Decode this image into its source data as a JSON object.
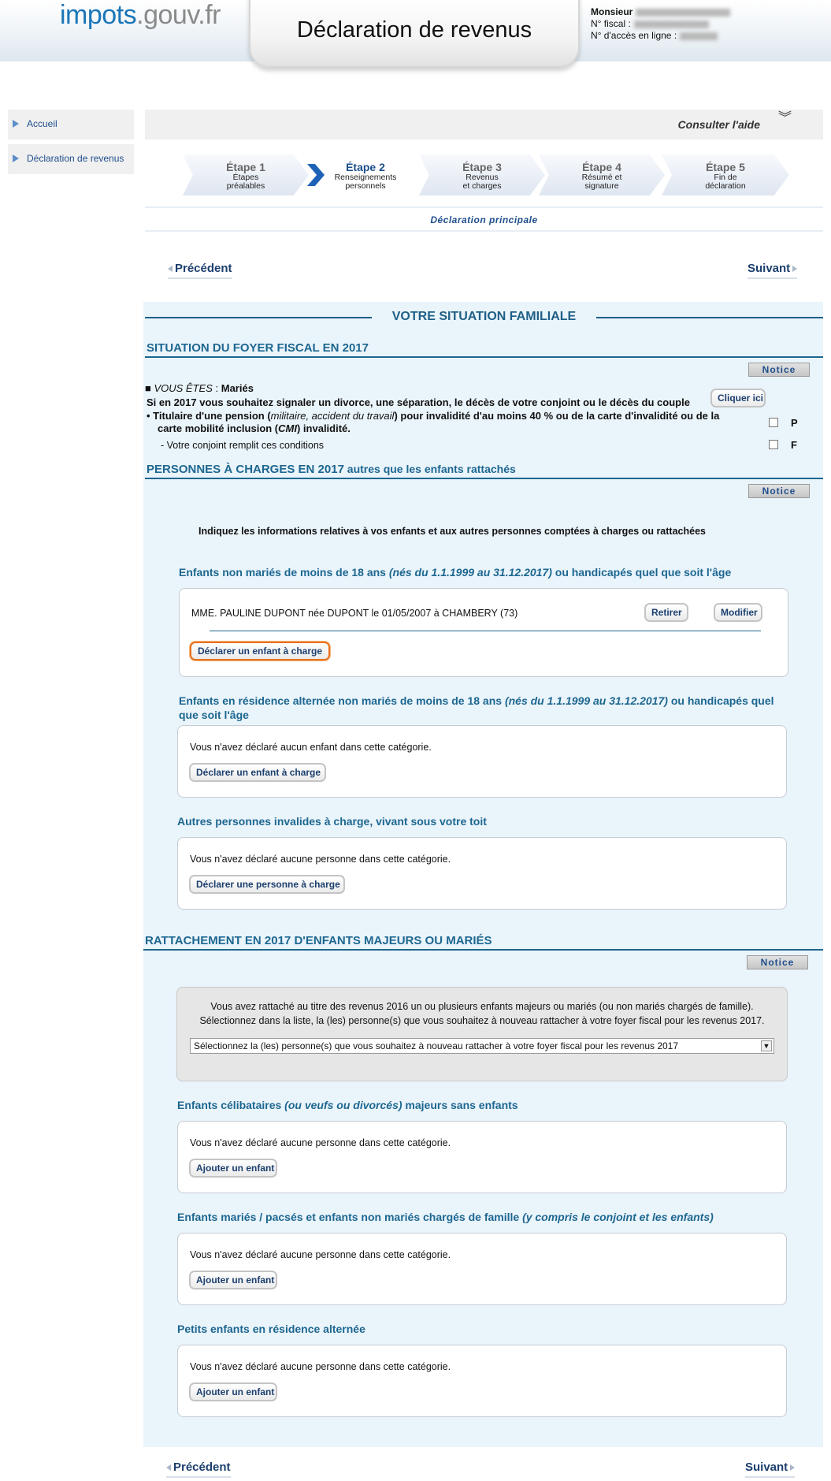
{
  "header": {
    "logo_part1": "impots",
    "logo_part2": ".gouv.fr",
    "title": "Déclaration de revenus",
    "user_label": "Monsieur",
    "fiscal_label": "N° fiscal :",
    "access_label": "N° d'accès en ligne :"
  },
  "sidebar": {
    "items": [
      {
        "label": "Accueil"
      },
      {
        "label": "Déclaration de revenus"
      }
    ]
  },
  "help": {
    "label": "Consulter l'aide",
    "icon": "double-chevron-down-icon"
  },
  "steps": [
    {
      "title": "Étape 1",
      "line1": "Étapes",
      "line2": "préalables"
    },
    {
      "title": "Étape 2",
      "line1": "Renseignements",
      "line2": "personnels"
    },
    {
      "title": "Étape 3",
      "line1": "Revenus",
      "line2": "et charges"
    },
    {
      "title": "Étape 4",
      "line1": "Résumé et",
      "line2": "signature"
    },
    {
      "title": "Étape 5",
      "line1": "Fin de",
      "line2": "déclaration"
    }
  ],
  "declaration_type": "Déclaration principale",
  "nav": {
    "prev": "Précédent",
    "next": "Suivant"
  },
  "family": {
    "banner": "VOTRE SITUATION FAMILIALE",
    "foyer_title": "SITUATION DU FOYER FISCAL EN 2017",
    "notice": "Notice",
    "vous_etes_prefix": "VOUS ÊTES",
    "vous_etes_colon": " : ",
    "vous_etes_value": "Mariés",
    "divorce_text": "Si en 2017 vous souhaitez signaler un divorce, une séparation, le décès de votre conjoint ou le décès du couple",
    "click_here": "Cliquer ici",
    "pension_1": "Titulaire d'une pension (",
    "pension_2": "militaire, accident du travail",
    "pension_3": ") pour invalidité d'au moins 40 % ou de la carte d'invalidité ou de la",
    "pension_4": "carte mobilité inclusion (",
    "pension_5": "CMI",
    "pension_6": ") invalidité.",
    "check_p": "P",
    "conjoint_text": "- Votre conjoint remplit ces conditions",
    "check_f": "F"
  },
  "charges": {
    "title_bold": "PERSONNES À CHARGES EN 2017",
    "title_rest": " autres que les enfants rattachés",
    "notice": "Notice",
    "intro": "Indiquez les informations relatives à vos enfants et aux autres personnes comptées à charges ou rattachées",
    "cat1_title_a": "Enfants non mariés de moins de 18 ans ",
    "cat1_title_b": "(nés du 1.1.1999 au 31.12.2017)",
    "cat1_title_c": " ou handicapés quel que soit l'âge",
    "child_entry": "MME. PAULINE DUPONT née DUPONT le 01/05/2007 à CHAMBERY (73)",
    "retirer": "Retirer",
    "modifier": "Modifier",
    "declare_child": "Déclarer un enfant à charge",
    "cat2_title_a": "Enfants en résidence alternée non mariés de moins de 18 ans ",
    "cat2_title_b": "(nés du 1.1.1999 au 31.12.2017)",
    "cat2_title_c": " ou handicapés quel que soit l'âge",
    "cat2_empty": "Vous n'avez déclaré aucun enfant dans cette catégorie.",
    "declare_child_2": "Déclarer un enfant à charge",
    "cat3_title": "Autres personnes invalides à charge, vivant sous votre toit",
    "cat3_empty": "Vous n'avez déclaré aucune personne dans cette catégorie.",
    "declare_person": "Déclarer une personne à charge"
  },
  "rattachement": {
    "title": "RATTACHEMENT EN 2017 D'ENFANTS MAJEURS OU MARIÉS",
    "notice": "Notice",
    "info_line1": "Vous avez rattaché au titre des revenus 2016 un ou plusieurs enfants majeurs ou mariés (ou non mariés chargés de famille).",
    "info_line2": "Sélectionnez dans la liste, la (les) personne(s) que vous souhaitez à nouveau rattacher à votre foyer fiscal pour les revenus 2017.",
    "select_value": "Sélectionnez la (les) personne(s) que vous souhaitez à nouveau rattacher à votre foyer fiscal pour les revenus 2017",
    "cat1_title_a": "Enfants célibataires ",
    "cat1_title_b": "(ou veufs ou divorcés)",
    "cat1_title_c": " majeurs sans enfants",
    "cat1_empty": "Vous n'avez déclaré aucune personne dans cette catégorie.",
    "add_child_1": "Ajouter un enfant",
    "cat2_title_a": "Enfants mariés / pacsés et enfants non mariés chargés de famille ",
    "cat2_title_b": "(y compris le conjoint et les enfants)",
    "cat2_empty": "Vous n'avez déclaré aucune personne dans cette catégorie.",
    "add_child_2": "Ajouter un enfant",
    "cat3_title": "Petits enfants en résidence alternée",
    "cat3_empty": "Vous n'avez déclaré aucune personne dans cette catégorie.",
    "add_child_3": "Ajouter un enfant"
  }
}
